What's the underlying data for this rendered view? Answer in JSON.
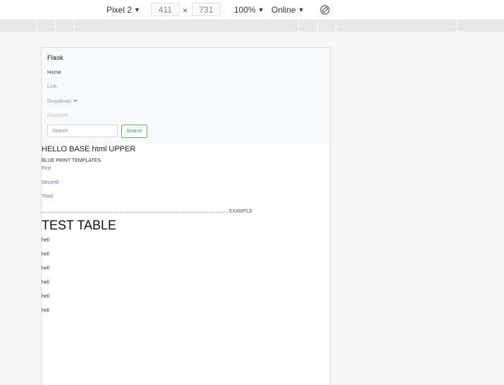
{
  "toolbar": {
    "device": "Pixel 2",
    "width": "411",
    "height": "731",
    "dimension_separator": "×",
    "zoom": "100%",
    "network": "Online",
    "caret": "▼",
    "rotate_icon": "rotate-icon"
  },
  "navbar": {
    "brand": "Flask",
    "links": [
      "Home",
      "Link",
      "Dropdown",
      "Disabled"
    ],
    "search_placeholder": "Search",
    "search_button": "Search"
  },
  "main": {
    "heading": "HELLO BASE html UPPER",
    "blueprint_title": "BLUE PRINT TEMPLATES",
    "blueprint_links": [
      "First",
      "Second",
      "Third"
    ],
    "example_label": "EXAMPLE",
    "table_title": "TEST TABLE",
    "rows": [
      "hell",
      "hell",
      "hell",
      "hell",
      "hell",
      "hell"
    ]
  },
  "colors": {
    "link": "#3b78c9",
    "success": "#28a745",
    "navbar_bg": "#f8f9fa"
  }
}
